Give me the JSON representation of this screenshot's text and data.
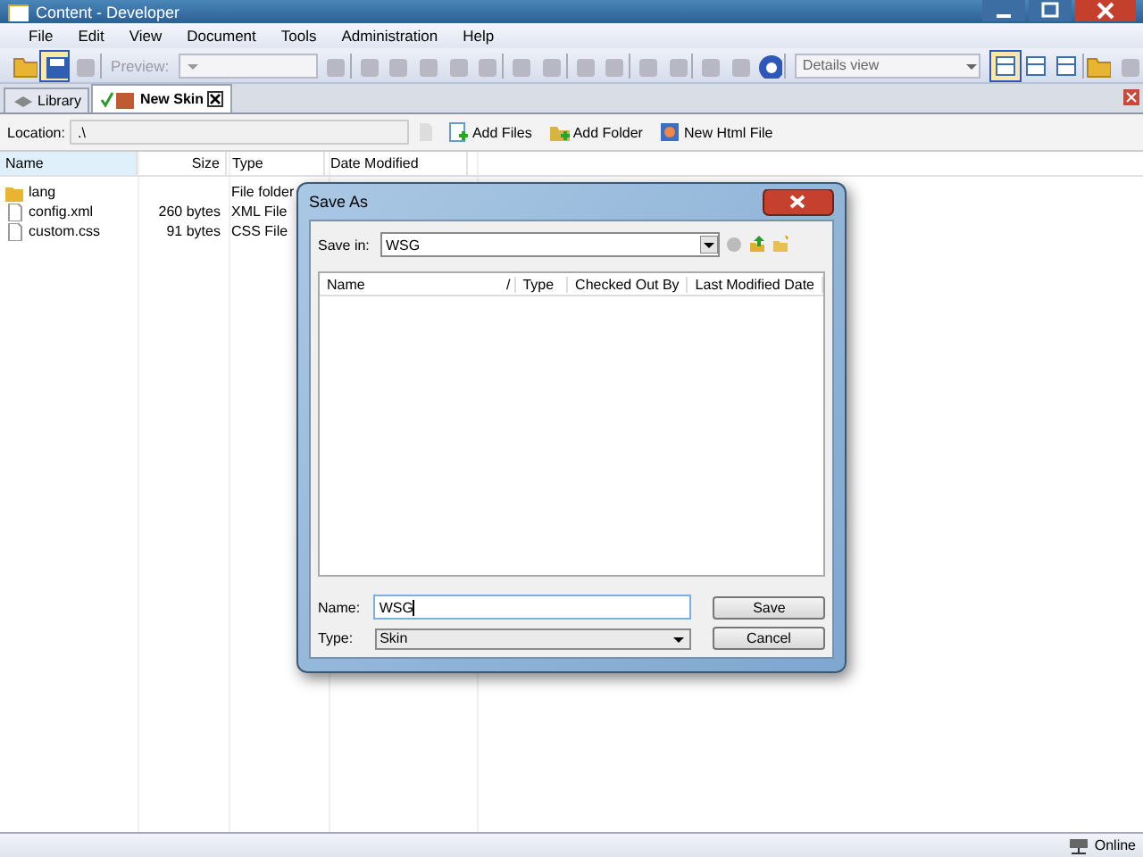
{
  "window": {
    "title": "Content - Developer"
  },
  "menu": [
    "File",
    "Edit",
    "View",
    "Document",
    "Tools",
    "Administration",
    "Help"
  ],
  "toolbar": {
    "preview_label": "Preview:",
    "view_combo": "Details view",
    "views": [
      {
        "selected": true
      },
      {
        "selected": false
      },
      {
        "selected": false
      }
    ]
  },
  "tabs": [
    {
      "label": "Library",
      "selected": false,
      "closable": false
    },
    {
      "label": "New Skin",
      "selected": true,
      "closable": true
    }
  ],
  "location": {
    "label": "Location:",
    "value": ".\\",
    "actions": [
      "Add Files",
      "Add Folder",
      "New Html File"
    ]
  },
  "file_list": {
    "columns": [
      "Name",
      "Size",
      "Type",
      "Date Modified"
    ],
    "rows": [
      {
        "kind": "folder",
        "name": "lang",
        "size": "",
        "type": "File folder"
      },
      {
        "kind": "file",
        "name": "config.xml",
        "size": "260 bytes",
        "type": "XML File"
      },
      {
        "kind": "file",
        "name": "custom.css",
        "size": "91 bytes",
        "type": "CSS File"
      }
    ]
  },
  "dialog": {
    "title": "Save As",
    "save_in_label": "Save in:",
    "save_in": "WSG",
    "columns": [
      "Name",
      "/",
      "Type",
      "Checked Out By",
      "Last Modified Date"
    ],
    "name_label": "Name:",
    "name_value": "WSG",
    "type_label": "Type:",
    "type_value": "Skin",
    "buttons": [
      "Save",
      "Cancel"
    ]
  },
  "status_bar": {
    "status": "Online"
  }
}
